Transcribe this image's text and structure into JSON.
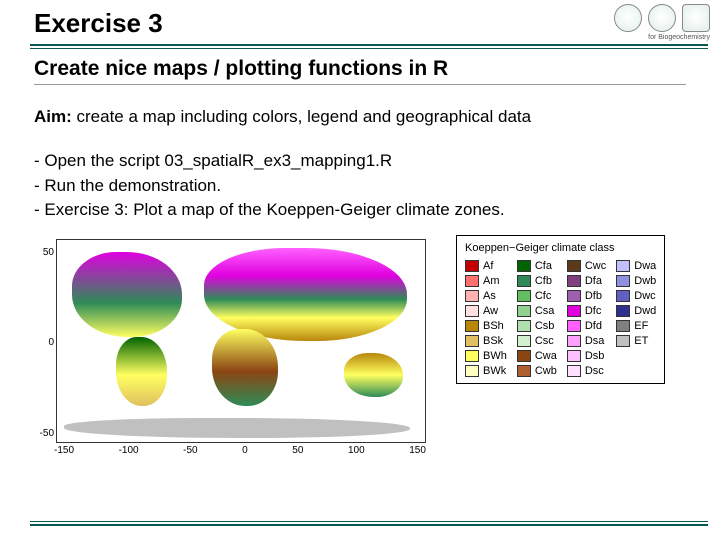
{
  "header": {
    "title": "Exercise 3",
    "org_caption": "for Biogeochemistry"
  },
  "subtitle": "Create nice maps / plotting functions in R",
  "aim_label": "Aim:",
  "aim_text": " create a map including colors, legend and geographical data",
  "steps": [
    "- Open the script 03_spatialR_ex3_mapping1.R",
    "- Run the demonstration.",
    "- Exercise 3: Plot a map of the Koeppen-Geiger climate zones."
  ],
  "chart_data": {
    "type": "map",
    "title": "Koeppen−Geiger climate class",
    "x_ticks": [
      "-150",
      "-100",
      "-50",
      "0",
      "50",
      "100",
      "150"
    ],
    "y_ticks": [
      "50",
      "0",
      "-50"
    ],
    "legend": [
      {
        "code": "Af",
        "color": "#c40000"
      },
      {
        "code": "Am",
        "color": "#ff7070"
      },
      {
        "code": "As",
        "color": "#ffb0b0"
      },
      {
        "code": "Aw",
        "color": "#ffe0e0"
      },
      {
        "code": "BSh",
        "color": "#b8860b"
      },
      {
        "code": "BSk",
        "color": "#e0c060"
      },
      {
        "code": "BWh",
        "color": "#ffff60"
      },
      {
        "code": "BWk",
        "color": "#ffffc0"
      },
      {
        "code": "Cfa",
        "color": "#006400"
      },
      {
        "code": "Cfb",
        "color": "#2e8b57"
      },
      {
        "code": "Cfc",
        "color": "#60c060"
      },
      {
        "code": "Csa",
        "color": "#90d090"
      },
      {
        "code": "Csb",
        "color": "#b0e0b0"
      },
      {
        "code": "Csc",
        "color": "#d0f0d0"
      },
      {
        "code": "Cwa",
        "color": "#8b4513"
      },
      {
        "code": "Cwb",
        "color": "#b06030"
      },
      {
        "code": "Cwc",
        "color": "#5a3a1a"
      },
      {
        "code": "Dfa",
        "color": "#804080"
      },
      {
        "code": "Dfb",
        "color": "#a060b0"
      },
      {
        "code": "Dfc",
        "color": "#e000e0"
      },
      {
        "code": "Dfd",
        "color": "#ff60ff"
      },
      {
        "code": "Dsa",
        "color": "#ffa0ff"
      },
      {
        "code": "Dsb",
        "color": "#ffc0ff"
      },
      {
        "code": "Dsc",
        "color": "#ffe0ff"
      },
      {
        "code": "Dwa",
        "color": "#c0c0ff"
      },
      {
        "code": "Dwb",
        "color": "#9090e0"
      },
      {
        "code": "Dwc",
        "color": "#6060c0"
      },
      {
        "code": "Dwd",
        "color": "#303090"
      },
      {
        "code": "EF",
        "color": "#808080"
      },
      {
        "code": "ET",
        "color": "#c0c0c0"
      }
    ]
  }
}
